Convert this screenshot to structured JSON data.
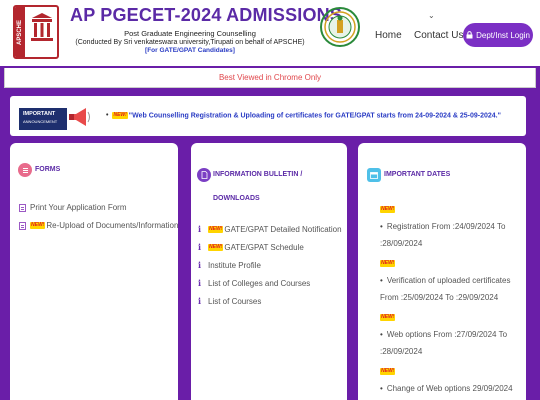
{
  "header": {
    "logo_text": "APSCHE",
    "title": "AP PGECET-2024 ADMISSIONS",
    "subtitle1": "Post Graduate Engineering Counselling",
    "subtitle2": "(Conducted By Sri venkateswara university,Tirupati on behalf of APSCHE)",
    "subtitle3": "[For GATE/GPAT Candidates]",
    "nav_home": "Home",
    "nav_contact": "Contact Us",
    "login_label": "Dept/Inst Login",
    "chevron": "⌄"
  },
  "best_viewed": "Best Viewed in Chrome Only",
  "announcement": {
    "badge_title": "IMPORTANT",
    "badge_sub": "ANNOUNCEMENT",
    "new_tag": "NEW!",
    "text": "\"Web Counselling Registration & Uploading of certificates for GATE/GPAT starts from 24-09-2024 & 25-09-2024.\""
  },
  "forms": {
    "heading": "FORMS",
    "items": [
      {
        "label": "Print Your Application Form"
      },
      {
        "label": "Re-Upload of Documents/Information",
        "new": "NEW!"
      }
    ]
  },
  "info": {
    "heading_line1": "INFORMATION BULLETIN /",
    "heading_line2": "DOWNLOADS",
    "items": [
      {
        "label": "GATE/GPAT Detailed Notification",
        "new": "NEW!"
      },
      {
        "label": "GATE/GPAT Schedule",
        "new": "NEW!"
      },
      {
        "label": "Institute Profile"
      },
      {
        "label": "List of Colleges and Courses"
      },
      {
        "label": "List of Courses"
      }
    ]
  },
  "dates": {
    "heading": "IMPORTANT DATES",
    "new_tag": "NEW!",
    "items": [
      {
        "line1": "Registration From :24/09/2024 To",
        "line2": ":28/09/2024"
      },
      {
        "line1": "Verification of uploaded certificates",
        "line2": "From :25/09/2024 To :29/09/2024"
      },
      {
        "line1": "Web options From :27/09/2024 To",
        "line2": ":28/09/2024"
      },
      {
        "line1": "Change of Web options 29/09/2024",
        "line2": ""
      }
    ]
  },
  "colors": {
    "background": "#6a1ea8",
    "title": "#5b2aa6",
    "login_button": "#7b2fc4",
    "best_viewed_text": "#e0474c",
    "announcement_text": "#2a3cc4",
    "forms_icon": "#e86b8c",
    "info_icon": "#7b3fc4",
    "dates_icon": "#4fc0e8"
  }
}
